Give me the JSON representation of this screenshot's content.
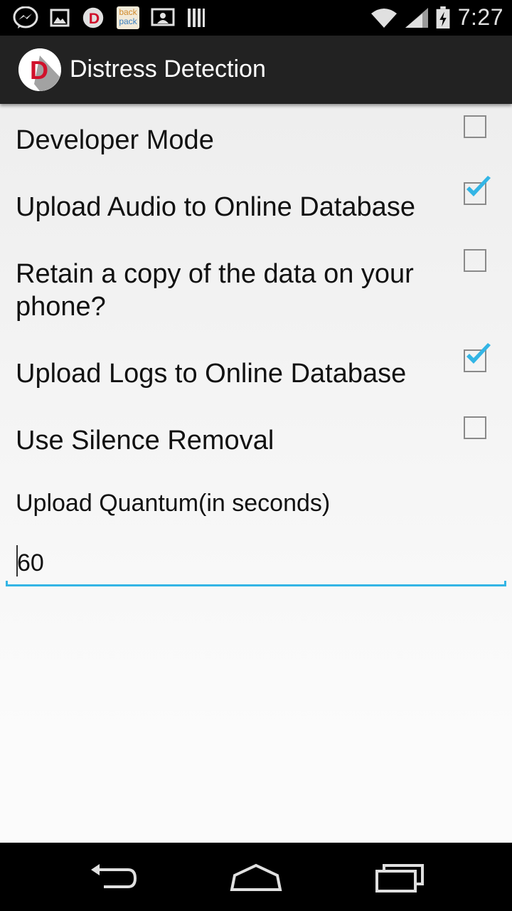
{
  "status_bar": {
    "time": "7:27",
    "icons": [
      "messenger-icon",
      "gallery-icon",
      "distress-app-icon",
      "backpack-icon",
      "cast-icon",
      "barcode-icon",
      "wifi-icon",
      "signal-icon",
      "battery-charging-icon"
    ],
    "backpack_text_1": "back",
    "backpack_text_2": "pack",
    "app_badge_letter": "D"
  },
  "action_bar": {
    "logo_letter": "D",
    "title": "Distress Detection",
    "accent_color": "#d0112b"
  },
  "preferences": [
    {
      "label": "Developer Mode",
      "checked": false
    },
    {
      "label": "Upload Audio to Online Database",
      "checked": true
    },
    {
      "label": "Retain a copy of the data on your phone?",
      "checked": false
    },
    {
      "label": "Upload Logs to Online Database",
      "checked": true
    },
    {
      "label": "Use Silence Removal",
      "checked": false
    }
  ],
  "upload_quantum": {
    "label": "Upload Quantum(in seconds)",
    "value": "60"
  },
  "nav_bar": {
    "buttons": [
      "back-icon",
      "home-icon",
      "recents-icon"
    ]
  },
  "colors": {
    "check": "#33b5e5",
    "action_bar_bg": "#222222",
    "input_underline": "#33b5e5"
  }
}
